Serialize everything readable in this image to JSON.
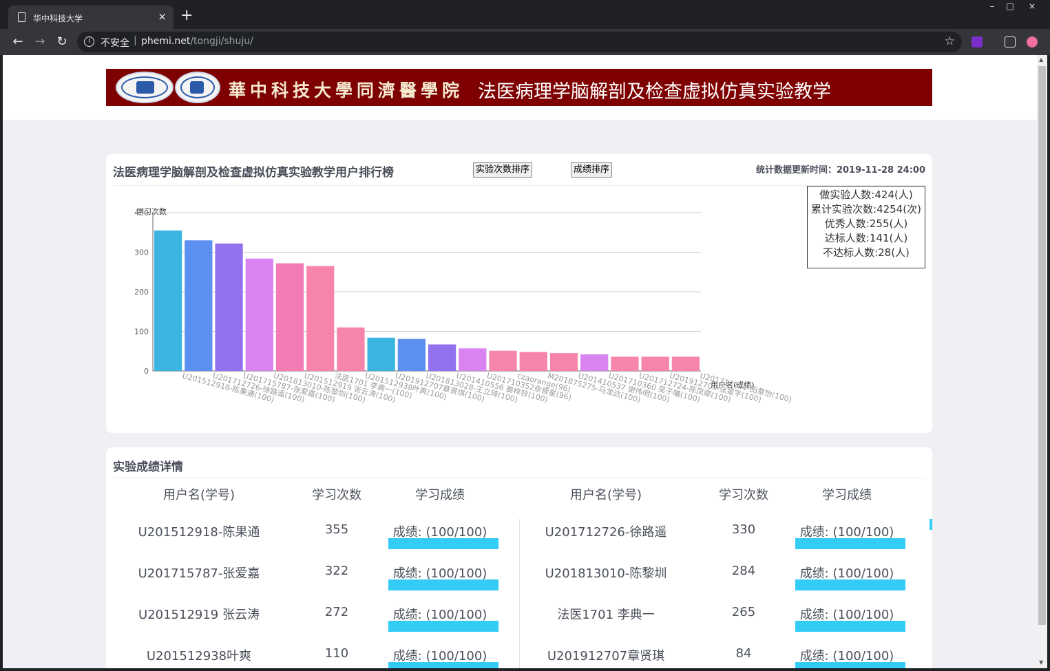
{
  "browser": {
    "tab_title": "华中科技大学",
    "tab_close": "×",
    "new_tab": "+",
    "insecure_label": "不安全",
    "url_host": "phemi.net",
    "url_path": "/tongji/shuju/",
    "win_min": "–",
    "win_max": "□",
    "win_close": "×"
  },
  "banner": {
    "school_name": "華中科技大學同濟醫學院",
    "subject": "法医病理学脑解剖及检查虚拟仿真实验教学"
  },
  "ranking": {
    "title": "法医病理学脑解剖及检查虚拟仿真实验教学用户排行榜",
    "sort_by_count_label": "实验次数排序",
    "sort_by_score_label": "成绩排序",
    "update_time": "统计数据更新时间：2019-11-28 24:00",
    "stats": [
      "做实验人数:424(人)",
      "累计实验次数:4254(次)",
      "优秀人数:255(人)",
      "达标人数:141(人)",
      "不达标人数:28(人)"
    ]
  },
  "chart_data": {
    "type": "bar",
    "ylabel": "学习次数",
    "xlabel": "用户名(成绩)",
    "ylim": [
      0,
      400
    ],
    "yticks": [
      0,
      100,
      200,
      300,
      400
    ],
    "categories": [
      "U201512918-陈果通(100)",
      "U201712726-徐路遥(100)",
      "U201715787-张爱嘉(100)",
      "U201813010-陈黎圳(100)",
      "U201512919 张云涛(100)",
      "法医1701 李典一(100)",
      "U201512938叶爽(100)",
      "U201912707章贤琪(100)",
      "U201813028-王立琦(100)",
      "U201410556 姜梓铃(100)",
      "U201710352余晋星(96)",
      "czaorange(96)",
      "M201875275-马龙达(100)",
      "U201410537 谢伟明(100)",
      "U201710360 吴子曦(100)",
      "U201712724-陈凤卿(100)",
      "U201912700-张星宇(100)",
      "U201712791-田意怡(100)"
    ],
    "values": [
      355,
      330,
      322,
      284,
      272,
      265,
      110,
      84,
      81,
      67,
      57,
      51,
      48,
      45,
      42,
      36,
      36,
      36
    ],
    "colors": [
      "#3bb5df",
      "#5b8ff0",
      "#9370ee",
      "#d883f0",
      "#f47bb3",
      "#f784ab",
      "#f784ab",
      "#3bb5df",
      "#5b8ff0",
      "#9370ee",
      "#d883f0",
      "#f784ab",
      "#f784ab",
      "#f784ab",
      "#d883f0",
      "#f784ab",
      "#f784ab",
      "#f784ab"
    ],
    "grid": true,
    "legend": "none"
  },
  "details": {
    "title": "实验成绩详情",
    "headers": [
      "用户名(学号)",
      "学习次数",
      "学习成绩"
    ],
    "rows": [
      {
        "left": {
          "name": "U201512918-陈果通",
          "count": "355",
          "score": "成绩: (100/100)",
          "fill": 1.0
        },
        "right": {
          "name": "U201712726-徐路遥",
          "count": "330",
          "score": "成绩: (100/100)",
          "fill": 1.0
        }
      },
      {
        "left": {
          "name": "U201715787-张爱嘉",
          "count": "322",
          "score": "成绩: (100/100)",
          "fill": 1.0
        },
        "right": {
          "name": "U201813010-陈黎圳",
          "count": "284",
          "score": "成绩: (100/100)",
          "fill": 1.0
        }
      },
      {
        "left": {
          "name": "U201512919 张云涛",
          "count": "272",
          "score": "成绩: (100/100)",
          "fill": 1.0
        },
        "right": {
          "name": "法医1701 李典一",
          "count": "265",
          "score": "成绩: (100/100)",
          "fill": 1.0
        }
      },
      {
        "left": {
          "name": "U201512938叶爽",
          "count": "110",
          "score": "成绩: (100/100)",
          "fill": 1.0
        },
        "right": {
          "name": "U201912707章贤琪",
          "count": "84",
          "score": "成绩: (100/100)",
          "fill": 1.0
        }
      }
    ]
  }
}
